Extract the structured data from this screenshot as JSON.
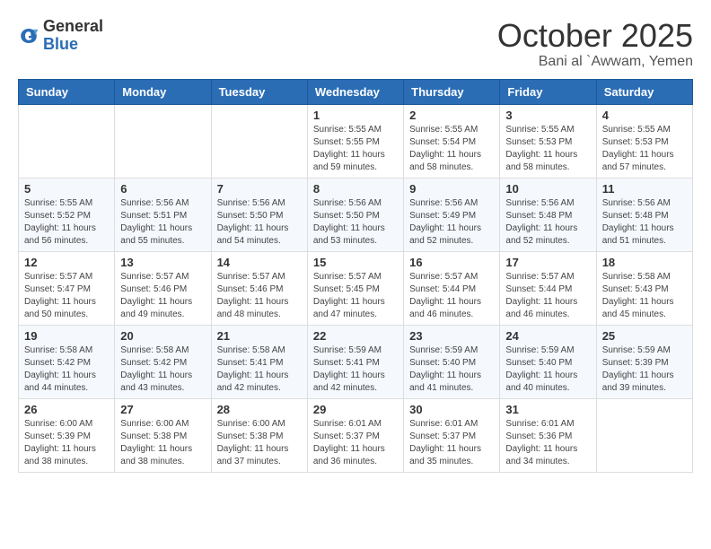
{
  "header": {
    "logo_general": "General",
    "logo_blue": "Blue",
    "month_title": "October 2025",
    "subtitle": "Bani al `Awwam, Yemen"
  },
  "weekdays": [
    "Sunday",
    "Monday",
    "Tuesday",
    "Wednesday",
    "Thursday",
    "Friday",
    "Saturday"
  ],
  "weeks": [
    [
      {
        "day": "",
        "info": ""
      },
      {
        "day": "",
        "info": ""
      },
      {
        "day": "",
        "info": ""
      },
      {
        "day": "1",
        "info": "Sunrise: 5:55 AM\nSunset: 5:55 PM\nDaylight: 11 hours\nand 59 minutes."
      },
      {
        "day": "2",
        "info": "Sunrise: 5:55 AM\nSunset: 5:54 PM\nDaylight: 11 hours\nand 58 minutes."
      },
      {
        "day": "3",
        "info": "Sunrise: 5:55 AM\nSunset: 5:53 PM\nDaylight: 11 hours\nand 58 minutes."
      },
      {
        "day": "4",
        "info": "Sunrise: 5:55 AM\nSunset: 5:53 PM\nDaylight: 11 hours\nand 57 minutes."
      }
    ],
    [
      {
        "day": "5",
        "info": "Sunrise: 5:55 AM\nSunset: 5:52 PM\nDaylight: 11 hours\nand 56 minutes."
      },
      {
        "day": "6",
        "info": "Sunrise: 5:56 AM\nSunset: 5:51 PM\nDaylight: 11 hours\nand 55 minutes."
      },
      {
        "day": "7",
        "info": "Sunrise: 5:56 AM\nSunset: 5:50 PM\nDaylight: 11 hours\nand 54 minutes."
      },
      {
        "day": "8",
        "info": "Sunrise: 5:56 AM\nSunset: 5:50 PM\nDaylight: 11 hours\nand 53 minutes."
      },
      {
        "day": "9",
        "info": "Sunrise: 5:56 AM\nSunset: 5:49 PM\nDaylight: 11 hours\nand 52 minutes."
      },
      {
        "day": "10",
        "info": "Sunrise: 5:56 AM\nSunset: 5:48 PM\nDaylight: 11 hours\nand 52 minutes."
      },
      {
        "day": "11",
        "info": "Sunrise: 5:56 AM\nSunset: 5:48 PM\nDaylight: 11 hours\nand 51 minutes."
      }
    ],
    [
      {
        "day": "12",
        "info": "Sunrise: 5:57 AM\nSunset: 5:47 PM\nDaylight: 11 hours\nand 50 minutes."
      },
      {
        "day": "13",
        "info": "Sunrise: 5:57 AM\nSunset: 5:46 PM\nDaylight: 11 hours\nand 49 minutes."
      },
      {
        "day": "14",
        "info": "Sunrise: 5:57 AM\nSunset: 5:46 PM\nDaylight: 11 hours\nand 48 minutes."
      },
      {
        "day": "15",
        "info": "Sunrise: 5:57 AM\nSunset: 5:45 PM\nDaylight: 11 hours\nand 47 minutes."
      },
      {
        "day": "16",
        "info": "Sunrise: 5:57 AM\nSunset: 5:44 PM\nDaylight: 11 hours\nand 46 minutes."
      },
      {
        "day": "17",
        "info": "Sunrise: 5:57 AM\nSunset: 5:44 PM\nDaylight: 11 hours\nand 46 minutes."
      },
      {
        "day": "18",
        "info": "Sunrise: 5:58 AM\nSunset: 5:43 PM\nDaylight: 11 hours\nand 45 minutes."
      }
    ],
    [
      {
        "day": "19",
        "info": "Sunrise: 5:58 AM\nSunset: 5:42 PM\nDaylight: 11 hours\nand 44 minutes."
      },
      {
        "day": "20",
        "info": "Sunrise: 5:58 AM\nSunset: 5:42 PM\nDaylight: 11 hours\nand 43 minutes."
      },
      {
        "day": "21",
        "info": "Sunrise: 5:58 AM\nSunset: 5:41 PM\nDaylight: 11 hours\nand 42 minutes."
      },
      {
        "day": "22",
        "info": "Sunrise: 5:59 AM\nSunset: 5:41 PM\nDaylight: 11 hours\nand 42 minutes."
      },
      {
        "day": "23",
        "info": "Sunrise: 5:59 AM\nSunset: 5:40 PM\nDaylight: 11 hours\nand 41 minutes."
      },
      {
        "day": "24",
        "info": "Sunrise: 5:59 AM\nSunset: 5:40 PM\nDaylight: 11 hours\nand 40 minutes."
      },
      {
        "day": "25",
        "info": "Sunrise: 5:59 AM\nSunset: 5:39 PM\nDaylight: 11 hours\nand 39 minutes."
      }
    ],
    [
      {
        "day": "26",
        "info": "Sunrise: 6:00 AM\nSunset: 5:39 PM\nDaylight: 11 hours\nand 38 minutes."
      },
      {
        "day": "27",
        "info": "Sunrise: 6:00 AM\nSunset: 5:38 PM\nDaylight: 11 hours\nand 38 minutes."
      },
      {
        "day": "28",
        "info": "Sunrise: 6:00 AM\nSunset: 5:38 PM\nDaylight: 11 hours\nand 37 minutes."
      },
      {
        "day": "29",
        "info": "Sunrise: 6:01 AM\nSunset: 5:37 PM\nDaylight: 11 hours\nand 36 minutes."
      },
      {
        "day": "30",
        "info": "Sunrise: 6:01 AM\nSunset: 5:37 PM\nDaylight: 11 hours\nand 35 minutes."
      },
      {
        "day": "31",
        "info": "Sunrise: 6:01 AM\nSunset: 5:36 PM\nDaylight: 11 hours\nand 34 minutes."
      },
      {
        "day": "",
        "info": ""
      }
    ]
  ]
}
